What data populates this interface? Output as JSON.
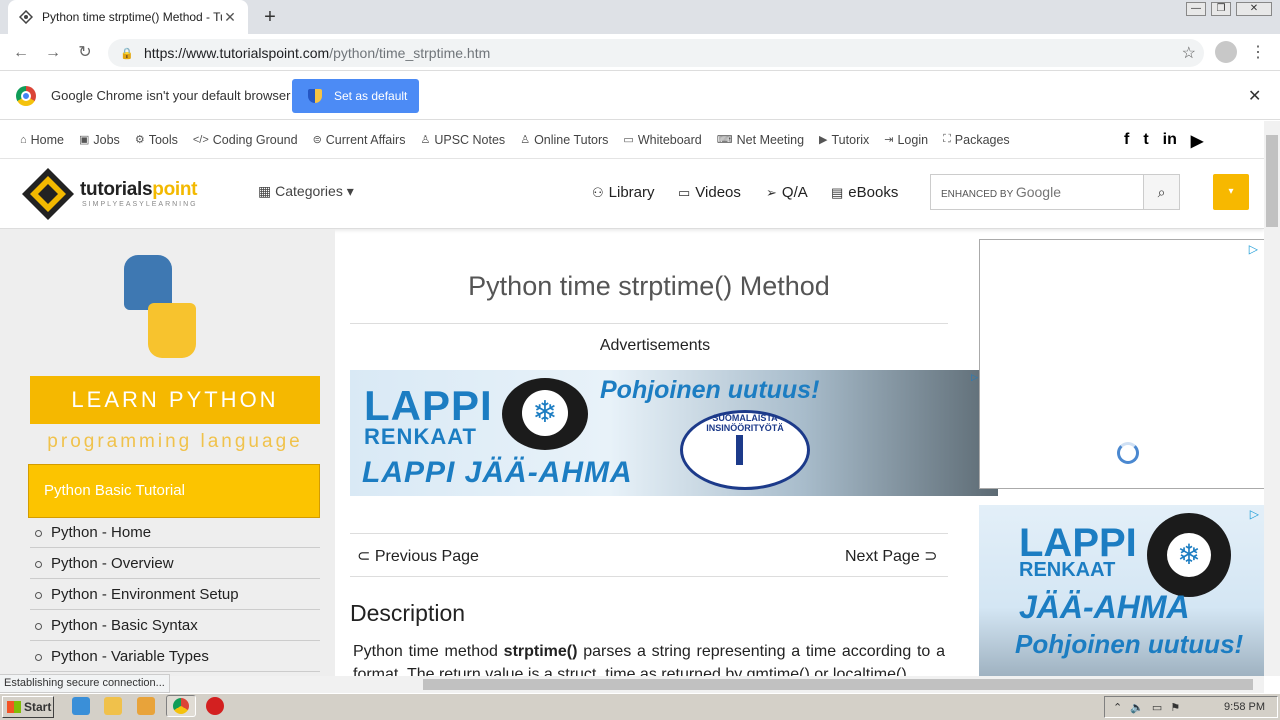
{
  "browser": {
    "tab_title": "Python time strptime() Method - Tuto",
    "tab_close": "✕",
    "new_tab": "+",
    "url_host": "https://www.tutorialspoint.com",
    "url_path": "/python/time_strptime.htm",
    "back": "←",
    "forward": "→",
    "reload": "↻",
    "star": "☆",
    "menu": "⋮"
  },
  "infobar": {
    "message": "Google Chrome isn't your default browser",
    "button": "Set as default",
    "close": "✕"
  },
  "topnav": [
    {
      "icon": "home-icon",
      "glyph": "⌂",
      "label": "Home"
    },
    {
      "icon": "briefcase-icon",
      "glyph": "▣",
      "label": "Jobs"
    },
    {
      "icon": "tools-icon",
      "glyph": "⚙",
      "label": "Tools"
    },
    {
      "icon": "code-icon",
      "glyph": "</>",
      "label": "Coding Ground"
    },
    {
      "icon": "affairs-icon",
      "glyph": "⊜",
      "label": "Current Affairs"
    },
    {
      "icon": "user-icon",
      "glyph": "♙",
      "label": "UPSC Notes"
    },
    {
      "icon": "tutor-icon",
      "glyph": "♙",
      "label": "Online Tutors"
    },
    {
      "icon": "whiteboard-icon",
      "glyph": "▭",
      "label": "Whiteboard"
    },
    {
      "icon": "meeting-icon",
      "glyph": "⌨",
      "label": "Net Meeting"
    },
    {
      "icon": "video-icon",
      "glyph": "▶",
      "label": "Tutorix"
    },
    {
      "icon": "login-icon",
      "glyph": "⇥",
      "label": "Login"
    },
    {
      "icon": "package-icon",
      "glyph": "⛶",
      "label": "Packages"
    }
  ],
  "social": {
    "facebook": "f",
    "twitter": "t",
    "linkedin": "in",
    "youtube": "▶"
  },
  "header": {
    "logo_main": "tutorials",
    "logo_accent": "point",
    "tagline": "SIMPLYEASYLEARNING",
    "categories": "Categories",
    "library": "Library",
    "videos": "Videos",
    "qa": "Q/A",
    "ebooks": "eBooks",
    "search_prefix": "ENHANCED BY",
    "search_brand": "Google",
    "search_btn": "⌕",
    "dropdown": "▾"
  },
  "sidebar": {
    "learn": "LEARN PYTHON",
    "programming": "programming language",
    "section": "Python Basic Tutorial",
    "items": [
      "Python - Home",
      "Python - Overview",
      "Python - Environment Setup",
      "Python - Basic Syntax",
      "Python - Variable Types"
    ]
  },
  "main": {
    "title": "Python time strptime() Method",
    "advertisements": "Advertisements",
    "banner": {
      "brand": "LAPPI",
      "brand2": "RENKAAT",
      "headline": "Pohjoinen uutuus!",
      "product": "LAPPI JÄÄ-AHMA",
      "badge": "SUOMALAISTA INSINÖÖRITYÖTÄ"
    },
    "prev": "Previous Page",
    "next": "Next Page",
    "description_heading": "Description",
    "description_pre": "Python time method ",
    "description_bold": "strptime()",
    "description_post": " parses a string representing a time according to a format. The return value is a struct_time as returned by gmtime() or localtime()."
  },
  "right_ad": {
    "brand": "LAPPI",
    "brand2": "RENKAAT",
    "product": "JÄÄ-AHMA",
    "headline": "Pohjoinen uutuus!"
  },
  "status": "Establishing secure connection...",
  "taskbar": {
    "start": "Start",
    "clock": "9:58 PM"
  }
}
